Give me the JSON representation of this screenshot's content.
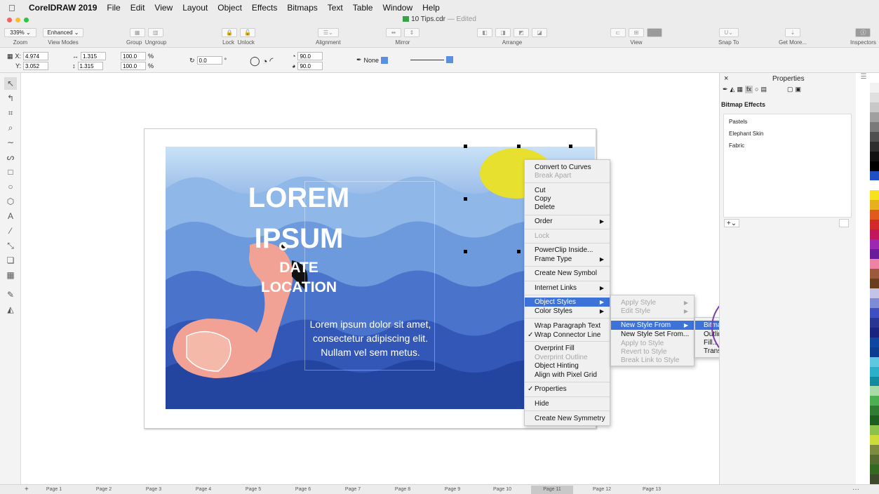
{
  "menubar": {
    "apple": "",
    "app": "CorelDRAW 2019",
    "items": [
      "File",
      "Edit",
      "View",
      "Layout",
      "Object",
      "Effects",
      "Bitmaps",
      "Text",
      "Table",
      "Window",
      "Help"
    ]
  },
  "document": {
    "title": "10 Tips.cdr",
    "status": "— Edited"
  },
  "toolbar": {
    "zoom_value": "339%",
    "zoom_label": "Zoom",
    "viewmode_value": "Enhanced",
    "viewmode_label": "View Modes",
    "group": "Group",
    "ungroup": "Ungroup",
    "lock": "Lock",
    "unlock": "Unlock",
    "alignment": "Alignment",
    "mirror": "Mirror",
    "arrange": "Arrange",
    "view": "View",
    "snapto": "Snap To",
    "getmore": "Get More...",
    "inspectors": "Inspectors"
  },
  "propbar": {
    "x": "4.974",
    "y": "3.052",
    "w": "1.315",
    "h": "1.315",
    "sx": "100.0",
    "sy": "100.0",
    "angle": "0.0",
    "start_angle": "90.0",
    "end_angle": "90.0",
    "outline": "None"
  },
  "artwork": {
    "line1": "LOREM",
    "line2": "IPSUM",
    "line3": "DATE",
    "line4": "LOCATION",
    "body": "Lorem ipsum dolor sit amet, consectetur adipiscing elit. Nullam vel sem metus."
  },
  "context_menu": {
    "items": [
      {
        "label": "Convert to Curves"
      },
      {
        "label": "Break Apart",
        "disabled": true
      },
      {
        "label": "Cut"
      },
      {
        "label": "Copy"
      },
      {
        "label": "Delete"
      },
      {
        "label": "Order"
      },
      {
        "label": "Lock",
        "disabled": true
      },
      {
        "label": "PowerClip Inside..."
      },
      {
        "label": "Frame Type"
      },
      {
        "label": "Create New Symbol"
      },
      {
        "label": "Internet Links"
      },
      {
        "label": "Object Styles"
      },
      {
        "label": "Color Styles"
      },
      {
        "label": "Wrap Paragraph Text"
      },
      {
        "label": "Wrap Connector Line"
      },
      {
        "label": "Overprint Fill"
      },
      {
        "label": "Overprint Outline",
        "disabled": true
      },
      {
        "label": "Object Hinting"
      },
      {
        "label": "Align with Pixel Grid"
      },
      {
        "label": "Properties"
      },
      {
        "label": "Hide"
      },
      {
        "label": "Create New Symmetry"
      }
    ]
  },
  "submenu_styles": {
    "items": [
      "Apply Style",
      "Edit Style",
      "New Style From",
      "New Style Set From...",
      "Apply to Style",
      "Revert to Style",
      "Break Link to Style"
    ]
  },
  "submenu_newstyle": {
    "items": [
      "Bitmap Effects",
      "Outline...",
      "Fill...",
      "Transparency..."
    ]
  },
  "properties": {
    "title": "Properties",
    "section": "Bitmap Effects",
    "effects": [
      "Pastels",
      "Elephant Skin",
      "Fabric"
    ],
    "add": "+"
  },
  "pages": [
    "Page 1",
    "Page 2",
    "Page 3",
    "Page 4",
    "Page 5",
    "Page 6",
    "Page 7",
    "Page 8",
    "Page 9",
    "Page 10",
    "Page 11",
    "Page 12",
    "Page 13"
  ],
  "active_page": "Page 11",
  "palette": [
    "#ffffff",
    "#f2f2f2",
    "#e0e0e0",
    "#c8c8c8",
    "#a0a0a0",
    "#7a7a7a",
    "#505050",
    "#2e2e2e",
    "#111111",
    "#000000",
    "#1f4fc4",
    "#ffffff",
    "#f6e31d",
    "#e8b01e",
    "#e05b1b",
    "#d22a2a",
    "#c2185b",
    "#9c27b0",
    "#6a1b9a",
    "#ee82a2",
    "#9c5a3c",
    "#6b3d1f",
    "#c3c3e8",
    "#7e8bd6",
    "#3f4fc2",
    "#283593",
    "#1a237e",
    "#0d47a1",
    "#0b3d91",
    "#5ec8e0",
    "#2ab0c9",
    "#138aa0",
    "#a8dba8",
    "#4caf50",
    "#2e7d32",
    "#1b5e20",
    "#8bc34a",
    "#cddc39",
    "#7d8b3c",
    "#556b2f",
    "#33691e",
    "#3b4a2a"
  ]
}
